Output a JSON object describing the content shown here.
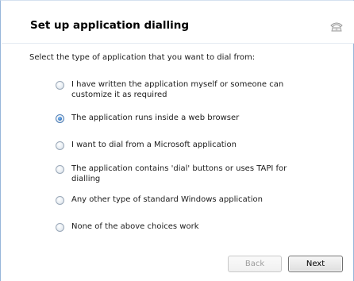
{
  "wizard": {
    "title": "Set up application dialling",
    "prompt": "Select the type of application that you want to dial from:",
    "options": [
      {
        "label": "I have written the application myself or someone can customize it as required",
        "checked": false
      },
      {
        "label": "The application runs inside a web browser",
        "checked": true
      },
      {
        "label": "I want to dial from a Microsoft application",
        "checked": false
      },
      {
        "label": "The application contains 'dial' buttons or uses TAPI for dialling",
        "checked": false
      },
      {
        "label": "Any other type of standard Windows application",
        "checked": false
      },
      {
        "label": "None of the above choices work",
        "checked": false
      }
    ],
    "back_label": "Back",
    "next_label": "Next",
    "back_enabled": false
  },
  "icons": {
    "corner": "telephone-icon"
  },
  "colors": {
    "frame_border": "#97b6da",
    "selected_radio": "#2a6fbf"
  }
}
